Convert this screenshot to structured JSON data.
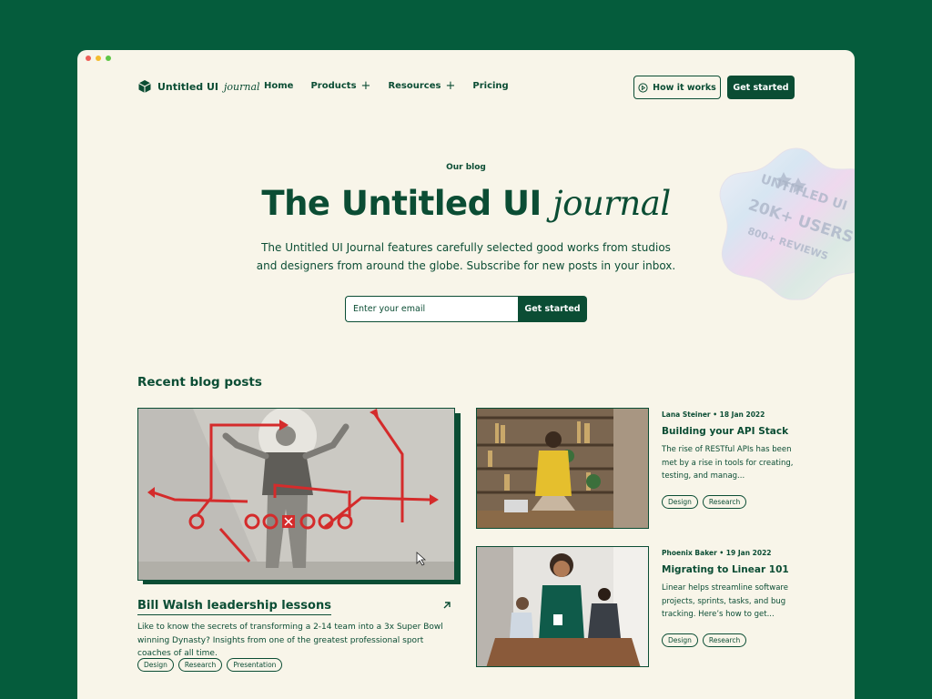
{
  "brand": {
    "name": "Untitled UI",
    "name_italic": "journal"
  },
  "nav": {
    "items": [
      {
        "label": "Home",
        "has_plus": false
      },
      {
        "label": "Products",
        "has_plus": true
      },
      {
        "label": "Resources",
        "has_plus": true
      },
      {
        "label": "Pricing",
        "has_plus": false
      }
    ],
    "how_it_works": "How it works",
    "get_started": "Get started"
  },
  "hero": {
    "eyebrow": "Our blog",
    "title": "The Untitled UI",
    "title_italic": "journal",
    "subtitle": "The Untitled UI Journal features carefully selected good works from studios and designers from around the globe. Subscribe for new posts in your inbox.",
    "email_placeholder": "Enter your email",
    "cta": "Get started"
  },
  "badge": {
    "line1": "UNTITLED UI",
    "line2": "20K+ USERS",
    "line3": "800+ REVIEWS"
  },
  "section": {
    "title": "Recent blog posts"
  },
  "featured": {
    "title": "Bill Walsh leadership lessons",
    "description": "Like to know the secrets of transforming a 2-14 team into a 3x Super Bowl winning Dynasty? Insights from one of the greatest professional sport coaches of all time.",
    "tags": [
      "Design",
      "Research",
      "Presentation"
    ]
  },
  "posts": [
    {
      "meta": "Lana Steiner • 18 Jan 2022",
      "title": "Building your API Stack",
      "description": "The rise of RESTful APIs has been met by a rise in tools for creating, testing, and manag...",
      "tags": [
        "Design",
        "Research"
      ]
    },
    {
      "meta": "Phoenix Baker • 19 Jan 2022",
      "title": "Migrating to Linear 101",
      "description": "Linear helps streamline software projects, sprints, tasks, and bug tracking. Here’s how to get...",
      "tags": [
        "Design",
        "Research"
      ]
    }
  ],
  "colors": {
    "brand": "#0b4d34",
    "page_bg": "#055c3c",
    "surface": "#f8f5e9",
    "accent_red": "#d42b2b"
  },
  "icons": {
    "logo": "cube-icon",
    "play": "play-circle-icon",
    "arrow": "arrow-up-right-icon"
  }
}
